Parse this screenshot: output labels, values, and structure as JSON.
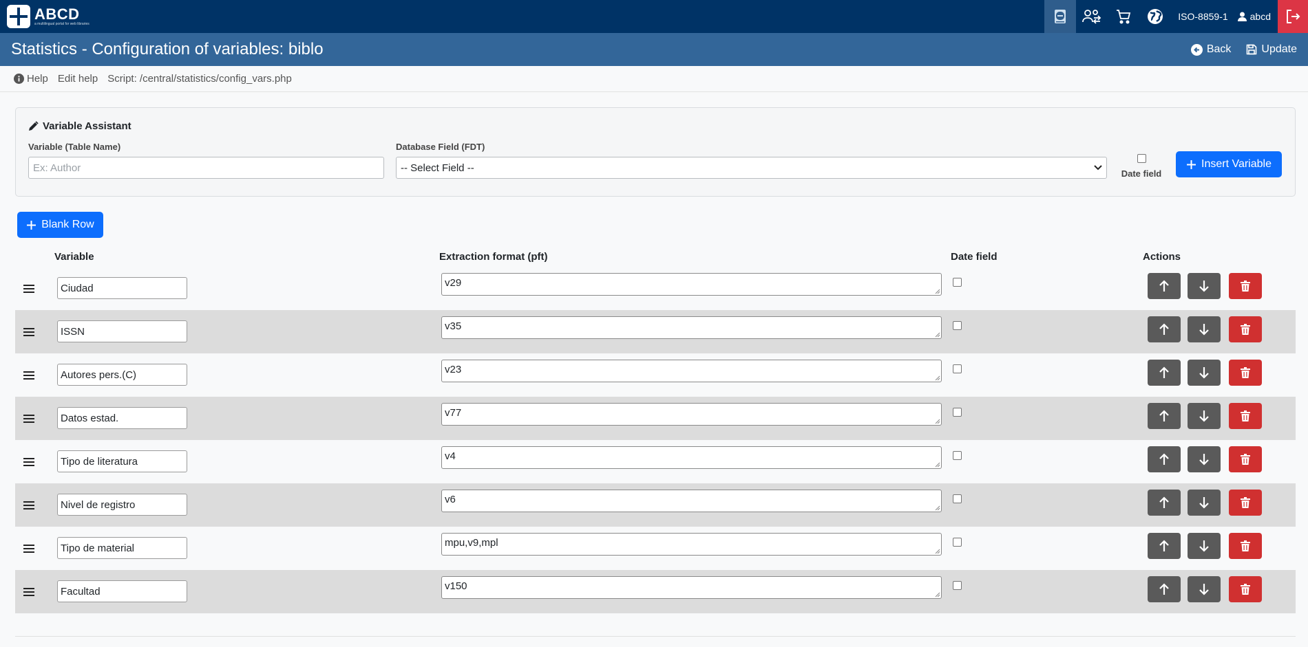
{
  "app": {
    "brand": "ABCD",
    "brand_tagline": "a multilingual portal for web libraries",
    "charset": "ISO-8859-1",
    "user": "abcd"
  },
  "page": {
    "title": "Statistics - Configuration of variables: biblo",
    "back_label": "Back",
    "update_label": "Update"
  },
  "helpbar": {
    "help": "Help",
    "edit_help": "Edit help",
    "script": "Script: /central/statistics/config_vars.php"
  },
  "assistant": {
    "title": "Variable Assistant",
    "variable_label": "Variable (Table Name)",
    "variable_placeholder": "Ex: Author",
    "field_label": "Database Field (FDT)",
    "field_selected": "-- Select Field --",
    "date_label": "Date field",
    "insert_label": "Insert Variable"
  },
  "blank_row_label": "Blank Row",
  "table": {
    "headers": {
      "variable": "Variable",
      "format": "Extraction format (pft)",
      "date": "Date field",
      "actions": "Actions"
    },
    "rows": [
      {
        "variable": "Ciudad",
        "format": "v29"
      },
      {
        "variable": "ISSN",
        "format": "v35"
      },
      {
        "variable": "Autores pers.(C)",
        "format": "v23"
      },
      {
        "variable": "Datos estad.",
        "format": "v77"
      },
      {
        "variable": "Tipo de literatura",
        "format": "v4"
      },
      {
        "variable": "Nivel de registro",
        "format": "v6"
      },
      {
        "variable": "Tipo de material",
        "format": "mpu,v9,mpl"
      },
      {
        "variable": "Facultad",
        "format": "v150"
      }
    ]
  },
  "colors": {
    "navbar": "#003366",
    "titlebar": "#336699",
    "primary": "#0d6efd",
    "danger": "#d03030"
  }
}
